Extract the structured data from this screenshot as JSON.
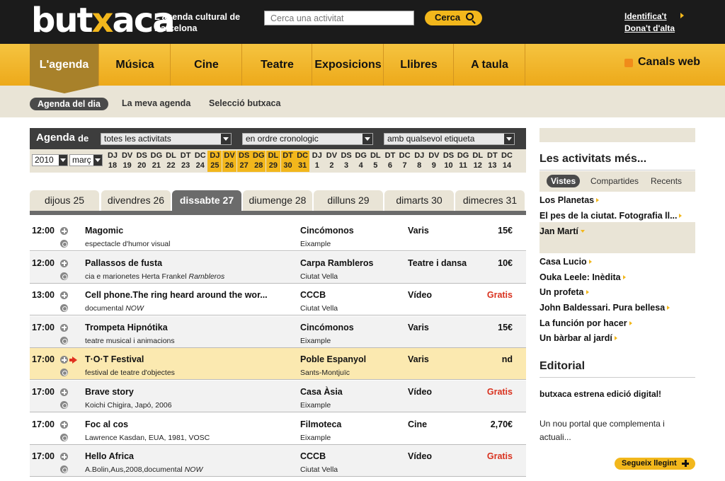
{
  "header": {
    "logo_pre": "but",
    "logo_x": "x",
    "logo_post": "aca",
    "tagline": "L'agenda cultural de Barcelona",
    "search_placeholder": "Cerca una activitat",
    "search_button": "Cerca",
    "login": "Identifica't",
    "signup": "Dona't d'alta"
  },
  "nav": {
    "items": [
      "L'agenda",
      "Música",
      "Cine",
      "Teatre",
      "Exposicions",
      "Llibres",
      "A taula"
    ],
    "feeds": "Canals web"
  },
  "subnav": {
    "items": [
      "Agenda del dia",
      "La meva agenda",
      "Selecció butxaca"
    ]
  },
  "agenda": {
    "title": "Agenda",
    "de": "de",
    "filter_activity": "totes les activitats",
    "filter_order": "en ordre cronologic",
    "filter_tag": "amb qualsevol etiqueta",
    "year": "2010",
    "month": "març",
    "days": [
      {
        "d": "DJ",
        "n": "18"
      },
      {
        "d": "DV",
        "n": "19"
      },
      {
        "d": "DS",
        "n": "20"
      },
      {
        "d": "DG",
        "n": "21"
      },
      {
        "d": "DL",
        "n": "22"
      },
      {
        "d": "DT",
        "n": "23"
      },
      {
        "d": "DC",
        "n": "24"
      },
      {
        "d": "DJ",
        "n": "25",
        "hl": true
      },
      {
        "d": "DV",
        "n": "26",
        "hl": true
      },
      {
        "d": "DS",
        "n": "27",
        "hl": true
      },
      {
        "d": "DG",
        "n": "28",
        "hl": true
      },
      {
        "d": "DL",
        "n": "29",
        "hl": true
      },
      {
        "d": "DT",
        "n": "30",
        "hl": true
      },
      {
        "d": "DC",
        "n": "31",
        "hl": true
      },
      {
        "d": "DJ",
        "n": "1"
      },
      {
        "d": "DV",
        "n": "2"
      },
      {
        "d": "DS",
        "n": "3"
      },
      {
        "d": "DG",
        "n": "4"
      },
      {
        "d": "DL",
        "n": "5"
      },
      {
        "d": "DT",
        "n": "6"
      },
      {
        "d": "DC",
        "n": "7"
      },
      {
        "d": "DJ",
        "n": "8"
      },
      {
        "d": "DV",
        "n": "9"
      },
      {
        "d": "DS",
        "n": "10"
      },
      {
        "d": "DG",
        "n": "11"
      },
      {
        "d": "DL",
        "n": "12"
      },
      {
        "d": "DT",
        "n": "13"
      },
      {
        "d": "DC",
        "n": "14"
      }
    ],
    "tabs": [
      "dijous 25",
      "divendres 26",
      "dissabte 27",
      "diumenge 28",
      "dilluns 29",
      "dimarts 30",
      "dimecres 31"
    ],
    "events": [
      {
        "time": "12:00",
        "title": "Magomic",
        "desc": "espectacle d'humor visual",
        "desc_em": "",
        "venue": "Cincómonos",
        "area": "Eixample",
        "cat": "Varis",
        "price": "15€",
        "free": false
      },
      {
        "time": "12:00",
        "title": "Pallassos de fusta",
        "desc": "cia e marionetes Herta Frankel ",
        "desc_em": "Rambleros",
        "venue": "Carpa Rambleros",
        "area": "Ciutat Vella",
        "cat": "Teatre i dansa",
        "price": "10€",
        "free": false
      },
      {
        "time": "13:00",
        "title": "Cell phone.The ring heard around the wor...",
        "desc": "documental ",
        "desc_em": "NOW",
        "venue": "CCCB",
        "area": "Ciutat Vella",
        "cat": "Vídeo",
        "price": "Gratis",
        "free": true
      },
      {
        "time": "17:00",
        "title": "Trompeta Hipnótika",
        "desc": "teatre musical i animacions",
        "desc_em": "",
        "venue": "Cincómonos",
        "area": "Eixample",
        "cat": "Varis",
        "price": "15€",
        "free": false
      },
      {
        "time": "17:00",
        "title": "T·O·T Festival",
        "desc": "festival de teatre d'objectes",
        "desc_em": "",
        "venue": "Poble Espanyol",
        "area": "Sants-Montjuïc",
        "cat": "Varis",
        "price": "nd",
        "free": false,
        "featured": true
      },
      {
        "time": "17:00",
        "title": "Brave story",
        "desc": "Koichi Chigira, Japó, 2006",
        "desc_em": "",
        "venue": "Casa Àsia",
        "area": "Eixample",
        "cat": "Vídeo",
        "price": "Gratis",
        "free": true
      },
      {
        "time": "17:00",
        "title": "Foc al cos",
        "desc": "Lawrence Kasdan, EUA, 1981, VOSC",
        "desc_em": "",
        "venue": "Filmoteca",
        "area": "Eixample",
        "cat": "Cine",
        "price": "2,70€",
        "free": false
      },
      {
        "time": "17:00",
        "title": "Hello Africa",
        "desc": "A.Bolin,Aus,2008,documental ",
        "desc_em": "NOW",
        "venue": "CCCB",
        "area": "Ciutat Vella",
        "cat": "Vídeo",
        "price": "Gratis",
        "free": true
      }
    ]
  },
  "sidebar": {
    "heading": "Les activitats més...",
    "tabs": [
      "Vistes",
      "Compartides",
      "Recents"
    ],
    "links": [
      "Los Planetas",
      "El pes de la ciutat. Fotografia ll...",
      "Jan Martí",
      "Casa Lucio",
      "Ouka Leele: Inèdita",
      "Un profeta",
      "John Baldessari. Pura bellesa",
      "La función por hacer",
      "Un bàrbar al jardí"
    ],
    "editorial_heading": "Editorial",
    "editorial_title": "butxaca estrena edició digital!",
    "editorial_body": "Un nou portal que complementa i actuali...",
    "more": "Segueix llegint"
  },
  "colors": {
    "accent": "#f2b71c",
    "dark": "#1b1b1b",
    "free": "#d9321f",
    "beige": "#e9e4d6"
  }
}
